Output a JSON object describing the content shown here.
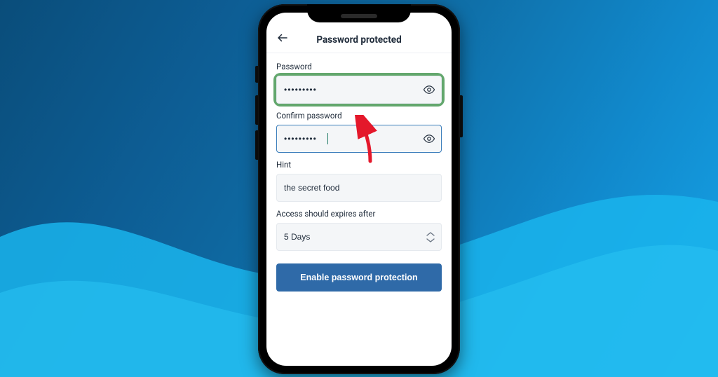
{
  "header": {
    "title": "Password protected"
  },
  "form": {
    "password": {
      "label": "Password",
      "value": "•••••••••"
    },
    "confirm": {
      "label": "Confirm password",
      "value": "•••••••••"
    },
    "hint": {
      "label": "Hint",
      "value": "the secret food"
    },
    "expires": {
      "label": "Access should expires after",
      "value": "5 Days"
    },
    "submit": "Enable password protection"
  }
}
